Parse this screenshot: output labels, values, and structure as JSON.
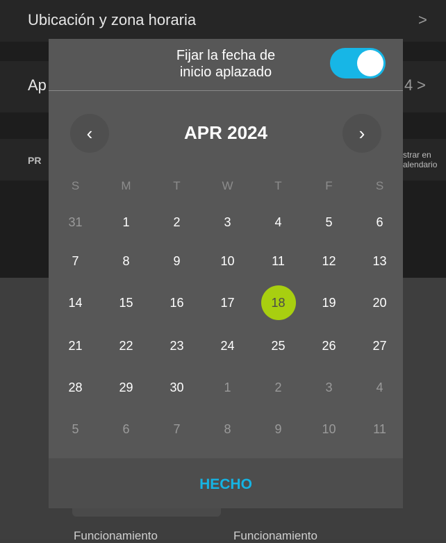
{
  "background": {
    "location_label": "Ubicación y zona horaria",
    "second_prefix": "Ap",
    "second_suffix": "4",
    "section_prefix": "PR",
    "side_text_line1": "strar en",
    "side_text_line2": "alendario",
    "func_left": "Funcionamiento",
    "func_right": "Funcionamiento"
  },
  "modal": {
    "title": "Fijar la fecha de\ninicio aplazado",
    "toggle_on": true,
    "month_label": "APR 2024",
    "prev_label": "‹",
    "next_label": "›",
    "weekdays": [
      "S",
      "M",
      "T",
      "W",
      "T",
      "F",
      "S"
    ],
    "weeks": [
      [
        "31",
        "1",
        "2",
        "3",
        "4",
        "5",
        "6"
      ],
      [
        "7",
        "8",
        "9",
        "10",
        "11",
        "12",
        "13"
      ],
      [
        "14",
        "15",
        "16",
        "17",
        "18",
        "19",
        "20"
      ],
      [
        "21",
        "22",
        "23",
        "24",
        "25",
        "26",
        "27"
      ],
      [
        "28",
        "29",
        "30",
        "1",
        "2",
        "3",
        "4"
      ],
      [
        "5",
        "6",
        "7",
        "8",
        "9",
        "10",
        "11"
      ]
    ],
    "selected_day": "18",
    "accent_color": "#17b6e6",
    "selected_color": "#a8cf10",
    "done_label": "HECHO"
  }
}
